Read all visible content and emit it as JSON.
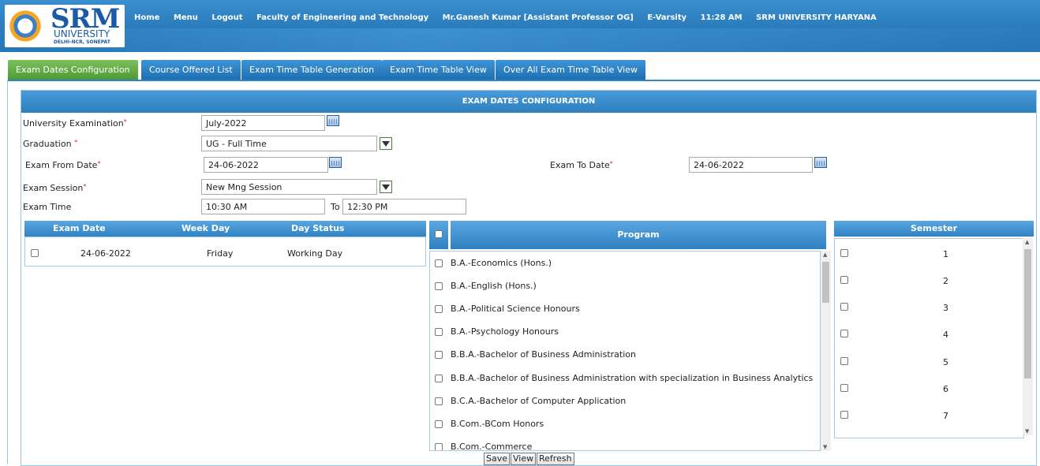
{
  "header": {
    "logo_text": "SRM",
    "logo_sub": "UNIVERSITY",
    "logo_loc": "DELHI-NCR, SONEPAT",
    "nav": [
      "Home",
      "Menu",
      "Logout",
      "Faculty of Engineering and Technology",
      "Mr.Ganesh Kumar [Assistant Professor OG]",
      "E-Varsity",
      "11:28 AM",
      "SRM UNIVERSITY HARYANA"
    ]
  },
  "tabs": [
    "Exam Dates Configuration",
    "Course Offered List",
    "Exam Time Table Generation",
    "Exam Time Table View",
    "Over All Exam Time Table View"
  ],
  "panel": {
    "title": "EXAM DATES CONFIGURATION",
    "req_mark": "*",
    "university_exam_label": "University Examination",
    "university_exam_value": "July-2022",
    "graduation_label": "Graduation",
    "graduation_value": "UG - Full Time",
    "exam_from_label": "Exam From Date",
    "exam_from_value": "24-06-2022",
    "exam_to_label": "Exam To Date",
    "exam_to_value": "24-06-2022",
    "exam_session_label": "Exam Session",
    "exam_session_value": "New Mng Session",
    "exam_time_label": "Exam Time",
    "exam_time_from": "10:30 AM",
    "to_label": "To",
    "exam_time_to": "12:30 PM"
  },
  "dates_table": {
    "headers": [
      "Exam Date",
      "Week Day",
      "Day Status"
    ],
    "rows": [
      [
        "24-06-2022",
        "Friday",
        "Working Day"
      ]
    ]
  },
  "programs": {
    "header": "Program",
    "items": [
      "B.A.-Economics (Hons.)",
      "B.A.-English (Hons.)",
      "B.A.-Political Science Honours",
      "B.A.-Psychology Honours",
      "B.B.A.-Bachelor of Business Administration",
      "B.B.A.-Bachelor of Business Administration with specialization in Business Analytics",
      "B.C.A.-Bachelor of Computer Application",
      "B.Com.-BCom Honors",
      "B.Com.-Commerce"
    ]
  },
  "semesters": {
    "header": "Semester",
    "items": [
      "1",
      "2",
      "3",
      "4",
      "5",
      "6",
      "7"
    ]
  },
  "buttons": {
    "save": "Save",
    "view": "View",
    "refresh": "Refresh"
  }
}
